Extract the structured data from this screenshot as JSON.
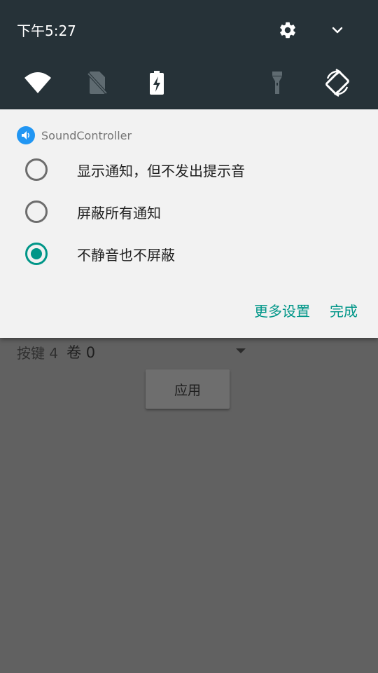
{
  "status_bar": {
    "time": "下午5:27"
  },
  "quick_settings": {
    "tiles": [
      {
        "name": "wifi-icon",
        "state": "on"
      },
      {
        "name": "no-sim-icon",
        "state": "off"
      },
      {
        "name": "battery-saver-icon",
        "state": "on"
      },
      {
        "name": "flashlight-icon",
        "state": "off"
      },
      {
        "name": "auto-rotate-icon",
        "state": "on"
      }
    ]
  },
  "notification": {
    "app_name": "SoundController",
    "options": [
      {
        "label": "显示通知，但不发出提示音",
        "checked": false
      },
      {
        "label": "屏蔽所有通知",
        "checked": false
      },
      {
        "label": "不静音也不屏蔽",
        "checked": true
      }
    ],
    "more_settings_label": "更多设置",
    "done_label": "完成"
  },
  "background_app": {
    "key_label": "按键 4",
    "key_value": "卷 0",
    "apply_label": "应用"
  },
  "colors": {
    "accent": "#009688",
    "qs_background": "#263238",
    "scrim": "#616161"
  }
}
